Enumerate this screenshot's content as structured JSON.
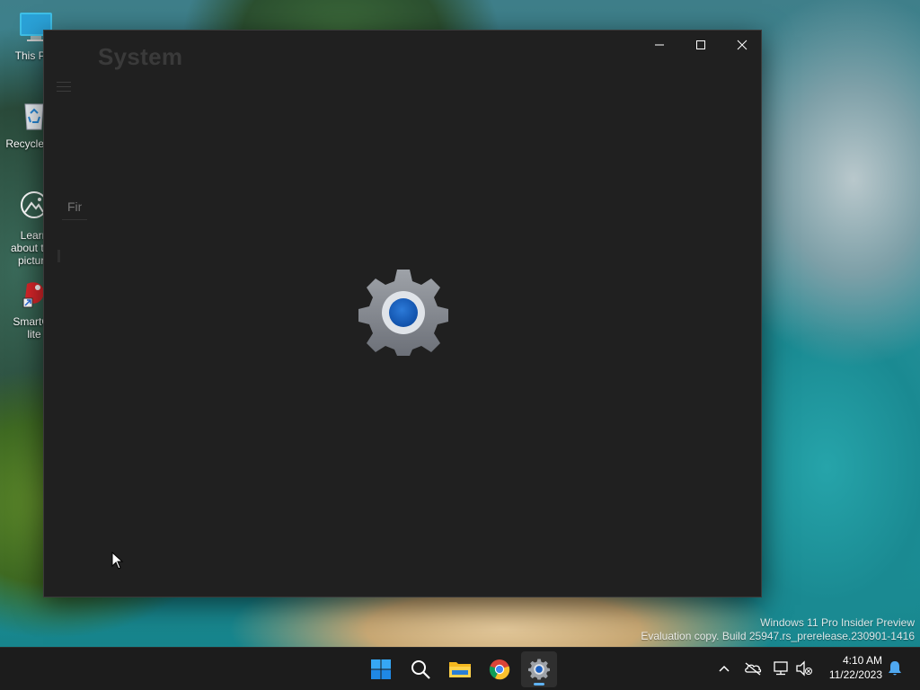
{
  "desktop": {
    "icons": [
      {
        "label": "This PC",
        "icon": "this-pc-icon"
      },
      {
        "label": "Recycle Bin",
        "icon": "recycle-bin-icon"
      },
      {
        "label": "Learn about this picture",
        "icon": "learn-about-picture-icon"
      },
      {
        "label": "SmartGit lite",
        "icon": "smartgit-icon"
      }
    ]
  },
  "window": {
    "title": "System",
    "search_placeholder": "Find a setting",
    "splash_icon": "settings-gear-icon",
    "caption": {
      "minimize": "minimize-icon",
      "maximize": "maximize-icon",
      "close": "close-icon"
    }
  },
  "watermark": {
    "line1": "Windows 11 Pro Insider Preview",
    "line2": "Evaluation copy. Build 25947.rs_prerelease.230901-1416"
  },
  "taskbar": {
    "apps": [
      "start-icon",
      "search-icon",
      "file-explorer-icon",
      "chrome-icon",
      "settings-icon"
    ],
    "tray": [
      "show-hidden-icons-chevron",
      "onedrive-icon",
      "network-icon",
      "volume-muted-icon",
      "notifications-icon"
    ],
    "time": "4:10 AM",
    "date": "11/22/2023"
  },
  "colors": {
    "accent": "#1e66c8",
    "taskbar": "#1c1c1c",
    "window_bg": "#202020"
  }
}
